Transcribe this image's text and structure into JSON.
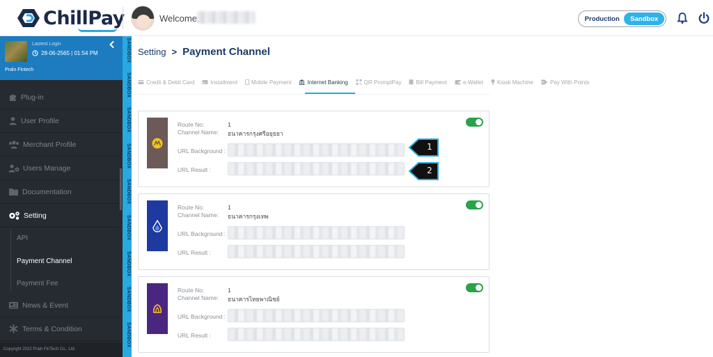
{
  "header": {
    "brand": "ChillPay",
    "welcome": "Welcome,",
    "env_production": "Production",
    "env_sandbox": "Sandbox",
    "bell_icon": "bell-icon",
    "power_icon": "power-icon",
    "colors": {
      "brand": "#1b2a4a",
      "accent": "#2fb2e8"
    }
  },
  "sidebar": {
    "profile": {
      "login_label": "Lastest Login",
      "login_date": "28-06-2565 | 01:54 PM",
      "name": "Praln Fintech"
    },
    "items": [
      {
        "label": "Plug-in",
        "icon": "puzzle-icon"
      },
      {
        "label": "User Profile",
        "icon": "user-icon"
      },
      {
        "label": "Merchant Profile",
        "icon": "users-icon"
      },
      {
        "label": "Users Manage",
        "icon": "users-gear-icon"
      },
      {
        "label": "Documentation",
        "icon": "folder-icon"
      },
      {
        "label": "Setting",
        "icon": "gears-icon"
      },
      {
        "label": "News & Event",
        "icon": "newspaper-icon"
      },
      {
        "label": "Terms & Condition",
        "icon": "asterisk-icon"
      }
    ],
    "sub_items": [
      {
        "label": "API"
      },
      {
        "label": "Payment Channel"
      },
      {
        "label": "Payment Fee"
      }
    ],
    "footer": "Copyright 2022 Praln FinTech Co., Ltd.",
    "colors": {
      "bg": "#262b31",
      "profile_bg": "#1d7bbf"
    }
  },
  "strip": {
    "label": "SANDBOX",
    "color": "#2aa9e0"
  },
  "main": {
    "breadcrumb": {
      "parent": "Setting",
      "separator": ">",
      "current": "Payment Channel"
    },
    "tabs": [
      {
        "label": "Credit & Debit Card",
        "icon": "credit-card-icon"
      },
      {
        "label": "Installment",
        "icon": "card-icon"
      },
      {
        "label": "Mobile Payment",
        "icon": "mobile-icon"
      },
      {
        "label": "Internet Banking",
        "icon": "bank-icon",
        "active": true
      },
      {
        "label": "QR PromptPay",
        "icon": "qr-icon"
      },
      {
        "label": "Bill Payment",
        "icon": "bill-icon"
      },
      {
        "label": "e-Wallet",
        "icon": "wallet-icon"
      },
      {
        "label": "Kiosk Machine",
        "icon": "kiosk-icon"
      },
      {
        "label": "Pay With Points",
        "icon": "tag-icon"
      }
    ],
    "labels": {
      "route_no": "Route No:",
      "channel_name": "Channel Name:",
      "url_background": "URL Background :",
      "url_result": "URL Result :"
    },
    "channels": [
      {
        "route_no": "1",
        "channel_name": "ธนาคารกรุงศรีอยุธยา",
        "logo_icon": "krungsri-logo-icon",
        "logo_color": "#6b5a57",
        "enabled": true
      },
      {
        "route_no": "1",
        "channel_name": "ธนาคารกรุงเทพ",
        "logo_icon": "bangkok-bank-logo-icon",
        "logo_color": "#1e3aa0",
        "enabled": true
      },
      {
        "route_no": "1",
        "channel_name": "ธนาคารไทยพาณิชย์",
        "logo_icon": "scb-logo-icon",
        "logo_color": "#4a2680",
        "enabled": true
      }
    ],
    "callouts": [
      "1",
      "2"
    ],
    "toggle_color": "#28a34a"
  }
}
